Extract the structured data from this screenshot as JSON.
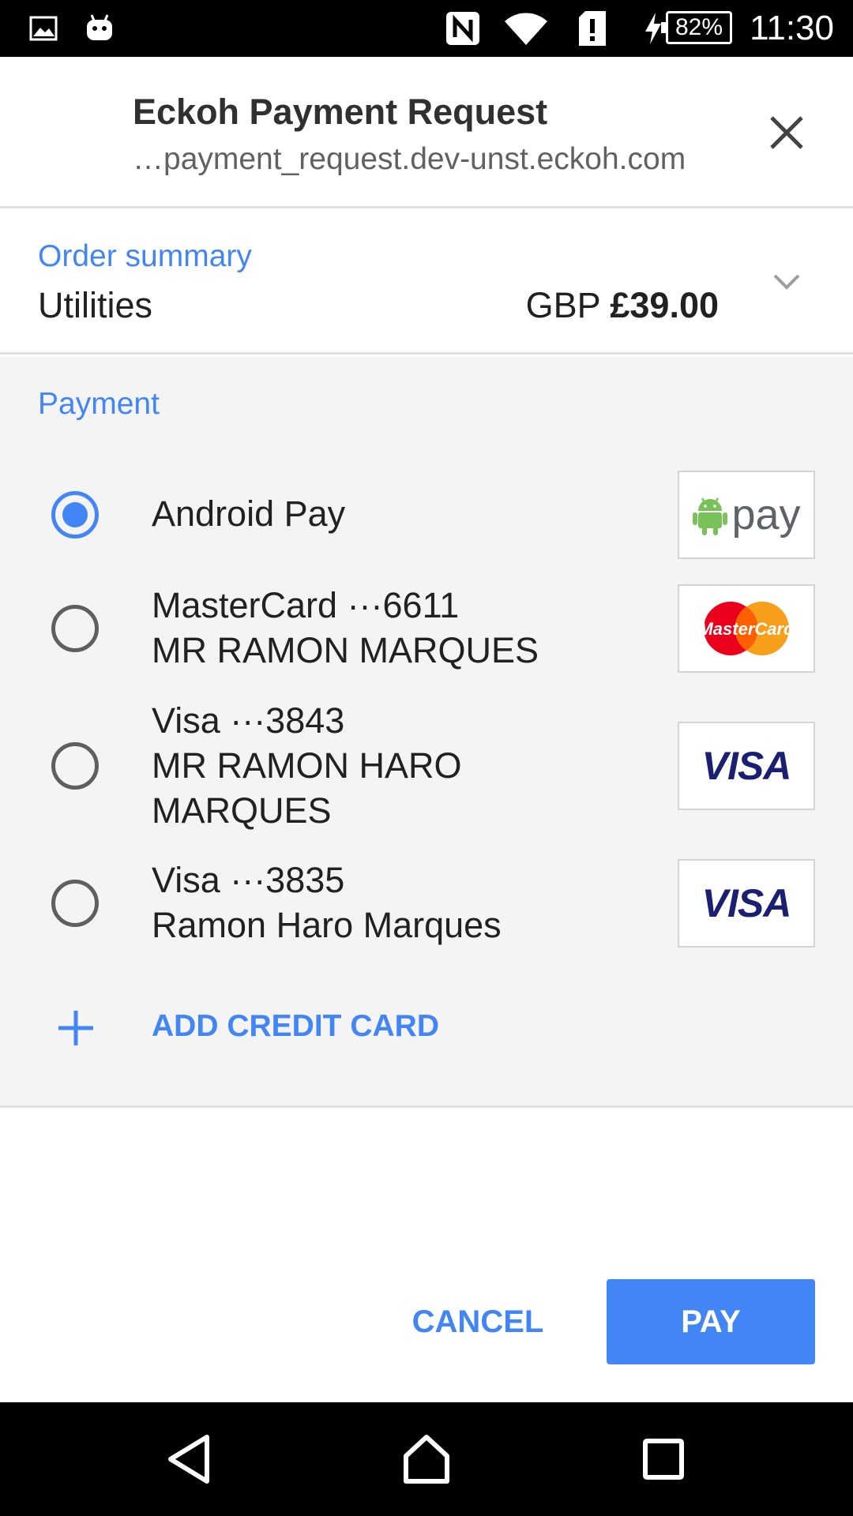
{
  "status_bar": {
    "time": "11:30",
    "battery": "82%",
    "icons": [
      "image-icon",
      "android-icon",
      "nfc-icon",
      "wifi-icon",
      "sim-alert-icon",
      "charging-icon",
      "battery-icon"
    ]
  },
  "header": {
    "title": "Eckoh Payment Request",
    "url": "…payment_request.dev-unst.eckoh.com",
    "close_icon": "close-icon"
  },
  "order_summary": {
    "label": "Order summary",
    "item": "Utilities",
    "currency": "GBP",
    "total": "£39.00",
    "expand_icon": "chevron-down-icon"
  },
  "payment": {
    "label": "Payment",
    "methods": [
      {
        "line1": "Android Pay",
        "line2": "",
        "line3": "",
        "selected": true,
        "logo": "android-pay-logo",
        "logo_text": "pay"
      },
      {
        "line1": "MasterCard ···6611",
        "line2": "MR RAMON MARQUES",
        "line3": "",
        "selected": false,
        "logo": "mastercard-logo",
        "logo_text": "MasterCard"
      },
      {
        "line1": "Visa ···3843",
        "line2": "MR RAMON HARO",
        "line3": "MARQUES",
        "selected": false,
        "logo": "visa-logo",
        "logo_text": "VISA"
      },
      {
        "line1": "Visa ···3835",
        "line2": "Ramon Haro Marques",
        "line3": "",
        "selected": false,
        "logo": "visa-logo",
        "logo_text": "VISA"
      }
    ],
    "add_card_label": "ADD CREDIT CARD"
  },
  "actions": {
    "cancel_label": "CANCEL",
    "pay_label": "PAY"
  },
  "colors": {
    "accent": "#4285f4",
    "status_bar": "#000000",
    "section_bg": "#f4f4f4"
  },
  "nav_bar": {
    "icons": [
      "back-icon",
      "home-icon",
      "recents-icon"
    ]
  }
}
